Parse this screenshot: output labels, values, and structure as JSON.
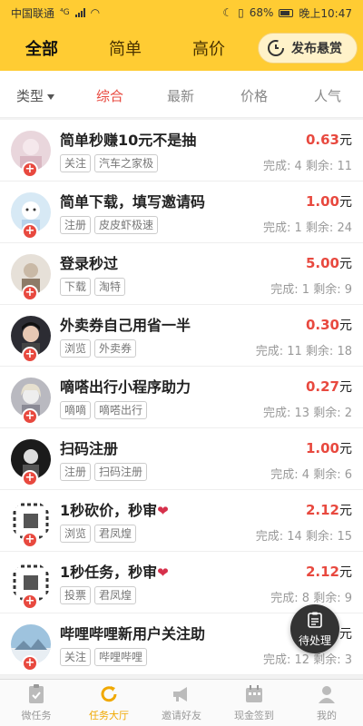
{
  "status_bar": {
    "carrier": "中国联通",
    "network": "⁴G",
    "battery": "68%",
    "time": "晚上10:47"
  },
  "header": {
    "tabs": [
      {
        "label": "全部"
      },
      {
        "label": "简单"
      },
      {
        "label": "高价"
      }
    ],
    "publish_label": "发布悬赏"
  },
  "filter": {
    "type_label": "类型",
    "sort_comprehensive": "综合",
    "sort_newest": "最新",
    "sort_price": "价格",
    "sort_popular": "人气"
  },
  "tasks": [
    {
      "title": "简单秒赚10元不是抽",
      "tags": [
        "关注",
        "汽车之家极"
      ],
      "price": "0.63",
      "unit": "元",
      "stats": "完成: 4 剩余: 11"
    },
    {
      "title": "简单下载，填写邀请码",
      "tags": [
        "注册",
        "皮皮虾极速"
      ],
      "price": "1.00",
      "unit": "元",
      "stats": "完成: 1 剩余: 24"
    },
    {
      "title": "登录秒过",
      "tags": [
        "下载",
        "淘特"
      ],
      "price": "5.00",
      "unit": "元",
      "stats": "完成: 1 剩余: 9"
    },
    {
      "title": "外卖券自己用省一半",
      "tags": [
        "浏览",
        "外卖券"
      ],
      "price": "0.30",
      "unit": "元",
      "stats": "完成: 11 剩余: 18"
    },
    {
      "title": "嘀嗒出行小程序助力",
      "tags": [
        "嘀嘀",
        "嘀嗒出行"
      ],
      "price": "0.27",
      "unit": "元",
      "stats": "完成: 13 剩余: 2"
    },
    {
      "title": "扫码注册",
      "tags": [
        "注册",
        "扫码注册"
      ],
      "price": "1.00",
      "unit": "元",
      "stats": "完成: 4 剩余: 6"
    },
    {
      "title": "1秒砍价，秒审",
      "tags": [
        "浏览",
        "君凤煌"
      ],
      "price": "2.12",
      "unit": "元",
      "stats": "完成: 14 剩余: 15"
    },
    {
      "title": "1秒任务，秒审",
      "tags": [
        "投票",
        "君凤煌"
      ],
      "price": "2.12",
      "unit": "元",
      "stats": "完成: 8 剩余: 9"
    },
    {
      "title": "哔哩哔哩新用户关注助",
      "tags": [
        "关注",
        "哔哩哔哩"
      ],
      "price": "",
      "unit": "元",
      "stats": "完成: 12 剩余: 3"
    }
  ],
  "fab_label": "待处理",
  "bottom_nav": [
    {
      "label": "微任务",
      "icon": "clipboard-icon"
    },
    {
      "label": "任务大厅",
      "icon": "refresh-icon"
    },
    {
      "label": "邀请好友",
      "icon": "megaphone-icon"
    },
    {
      "label": "现金签到",
      "icon": "calendar-icon"
    },
    {
      "label": "我的",
      "icon": "person-icon"
    }
  ],
  "colors": {
    "accent": "#ffcc33",
    "price": "#e8493f",
    "nav_active": "#f0a800"
  }
}
